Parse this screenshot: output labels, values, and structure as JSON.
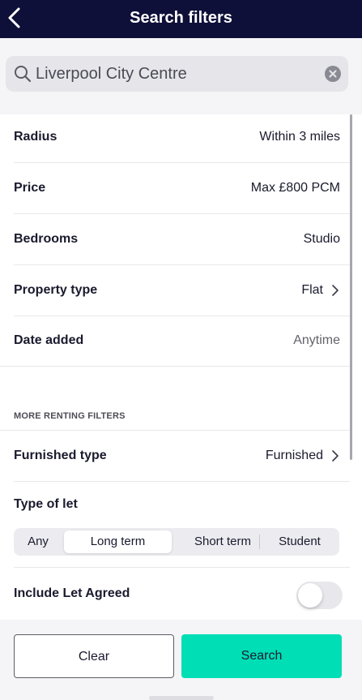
{
  "header": {
    "title": "Search filters"
  },
  "search": {
    "value": "Liverpool City Centre"
  },
  "filters": [
    {
      "label": "Radius",
      "value": "Within 3 miles"
    },
    {
      "label": "Price",
      "value": "Max £800 PCM"
    },
    {
      "label": "Bedrooms",
      "value": "Studio"
    },
    {
      "label": "Property type",
      "value": "Flat"
    },
    {
      "label": "Date added",
      "value": "Anytime"
    }
  ],
  "more_filters": {
    "heading": "MORE RENTING FILTERS",
    "furnished": {
      "label": "Furnished type",
      "value": "Furnished"
    },
    "type_of_let": {
      "label": "Type of let",
      "options": [
        "Any",
        "Long term",
        "Short term",
        "Student"
      ],
      "selected": "Long term"
    },
    "include_let_agreed": {
      "label": "Include Let Agreed",
      "enabled": false
    }
  },
  "footer": {
    "clear_label": "Clear",
    "search_label": "Search"
  },
  "colors": {
    "nav_bg": "#0e1039",
    "accent": "#00deb6"
  },
  "icons": {
    "back": "chevron-left-icon",
    "search": "search-icon",
    "clear": "clear-circle-icon",
    "disclosure": "chevron-right-icon"
  }
}
